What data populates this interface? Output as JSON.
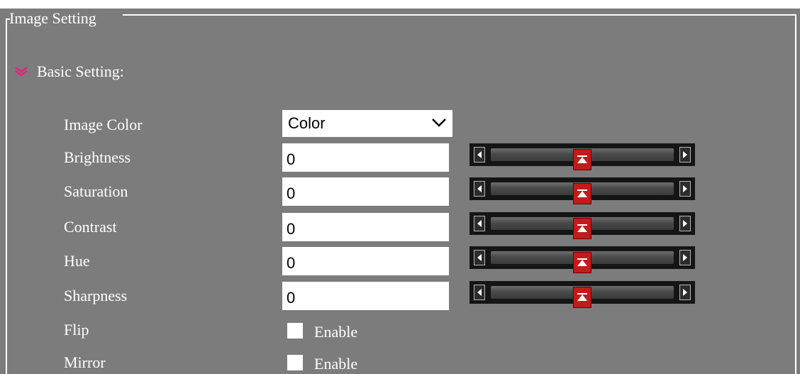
{
  "fieldset": {
    "legend": "Image Setting"
  },
  "section": {
    "title": "Basic Setting:",
    "arrow_icon": "double-chevron-down-icon",
    "arrow_color": "#d0307a"
  },
  "image_color": {
    "label": "Image Color",
    "value": "Color"
  },
  "controls": [
    {
      "key": "brightness",
      "label": "Brightness",
      "value": "0",
      "slider_level": 0.5
    },
    {
      "key": "saturation",
      "label": "Saturation",
      "value": "0",
      "slider_level": 0.5
    },
    {
      "key": "contrast",
      "label": "Contrast",
      "value": "0",
      "slider_level": 0.5
    },
    {
      "key": "hue",
      "label": "Hue",
      "value": "0",
      "slider_level": 0.5
    },
    {
      "key": "sharpness",
      "label": "Sharpness",
      "value": "0",
      "slider_level": 0.5
    }
  ],
  "flip": {
    "label": "Flip",
    "checkbox_label": "Enable",
    "checked": false
  },
  "mirror": {
    "label": "Mirror",
    "checkbox_label": "Enable",
    "checked": false
  },
  "colors": {
    "panel_bg": "#7c7c7c",
    "text": "#ffffff",
    "slider_thumb": "#c11b1b",
    "slider_bg": "#151515"
  }
}
